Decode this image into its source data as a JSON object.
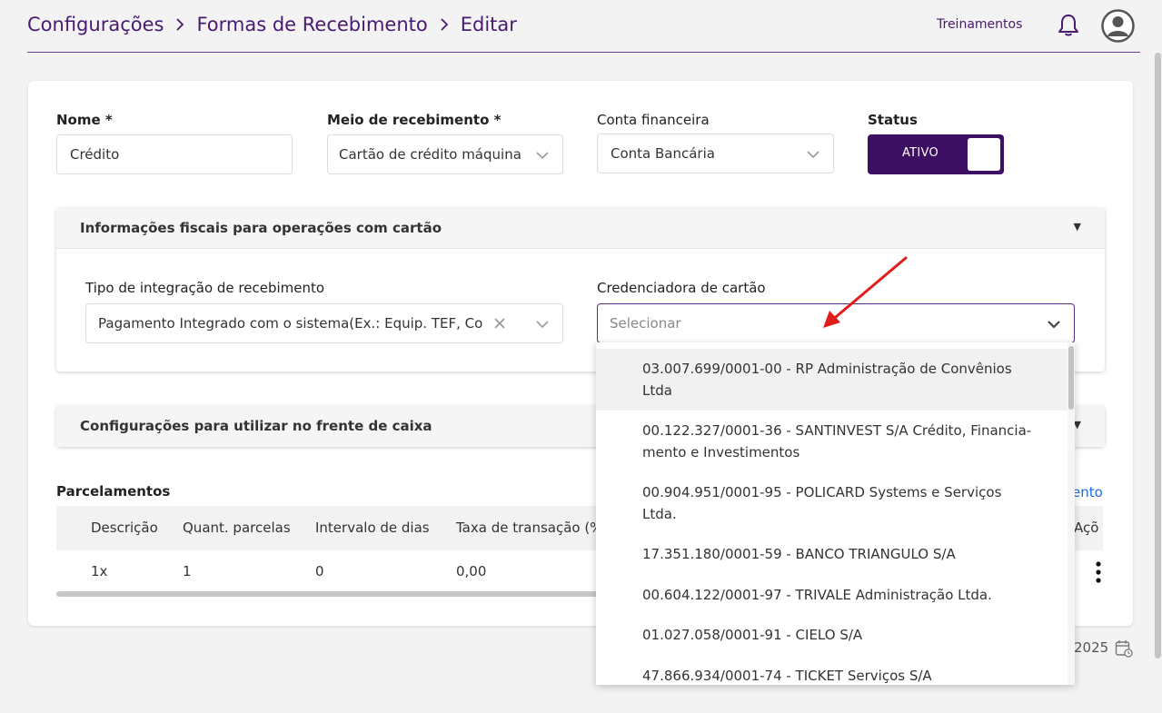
{
  "breadcrumb": [
    "Configurações",
    "Formas de Recebimento",
    "Editar"
  ],
  "header": {
    "training_link": "Treinamentos"
  },
  "form": {
    "name_label": "Nome *",
    "name_value": "Crédito",
    "means_label": "Meio de recebimento *",
    "means_value": "Cartão de crédito máquina",
    "account_label": "Conta financeira",
    "account_value": "Conta Bancária",
    "status_label": "Status",
    "status_value": "ATIVO"
  },
  "fiscal_panel": {
    "title": "Informações fiscais para operações com cartão",
    "integration_label": "Tipo de integração de recebimento",
    "integration_value": "Pagamento Integrado com o sistema(Ex.: Equip. TEF, Co",
    "acquirer_label": "Credenciadora de cartão",
    "acquirer_placeholder": "Selecionar"
  },
  "pos_panel": {
    "title": "Configurações para utilizar no frente de caixa"
  },
  "installments": {
    "title": "Parcelamentos",
    "add_link": "ento",
    "columns": [
      "Descrição",
      "Quant. parcelas",
      "Intervalo de dias",
      "Taxa de transação (%",
      "Açõ"
    ],
    "rows": [
      {
        "description": "1x",
        "quantity": "1",
        "interval": "0",
        "rate": "0,00"
      }
    ]
  },
  "footer": {
    "date_fragment": "2025"
  },
  "dropdown": {
    "options": [
      [
        "03.007.699/0001-00 - RP Administração de Convênios",
        "Ltda"
      ],
      [
        "00.122.327/0001-36 - SANTINVEST S/A Crédito, Financia-",
        "mento e Investimentos"
      ],
      [
        "00.904.951/0001-95 - POLICARD Systems e Serviços",
        "Ltda."
      ],
      [
        "17.351.180/0001-59 - BANCO TRIANGULO S/A"
      ],
      [
        "00.604.122/0001-97 - TRIVALE Administração Ltda."
      ],
      [
        "01.027.058/0001-91 - CIELO S/A"
      ],
      [
        "47.866.934/0001-74 - TICKET Serviços S/A"
      ]
    ]
  },
  "colors": {
    "brand": "#3d0f63",
    "link": "#1a6fe0",
    "arrow": "#e21b1b"
  }
}
